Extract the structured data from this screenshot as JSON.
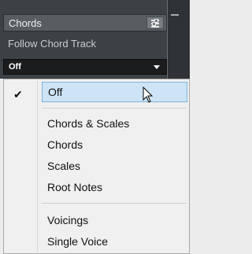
{
  "panel": {
    "title": "Chords",
    "follow_label": "Follow Chord Track",
    "dropdown_value": "Off"
  },
  "menu": {
    "selected": "Off",
    "items": [
      {
        "label": "Off"
      },
      {
        "label": "Chords & Scales"
      },
      {
        "label": "Chords"
      },
      {
        "label": "Scales"
      },
      {
        "label": "Root Notes"
      },
      {
        "label": "Voicings"
      },
      {
        "label": "Single Voice"
      }
    ]
  },
  "colors": {
    "panel_bg": "#3c4145",
    "menu_bg": "#f0f0f0",
    "selection_bg": "#cde4f6",
    "selection_border": "#7fb2dc"
  },
  "icons": [
    "menu-icon",
    "chevron-down-icon",
    "checkmark-icon",
    "mouse-pointer-icon"
  ]
}
